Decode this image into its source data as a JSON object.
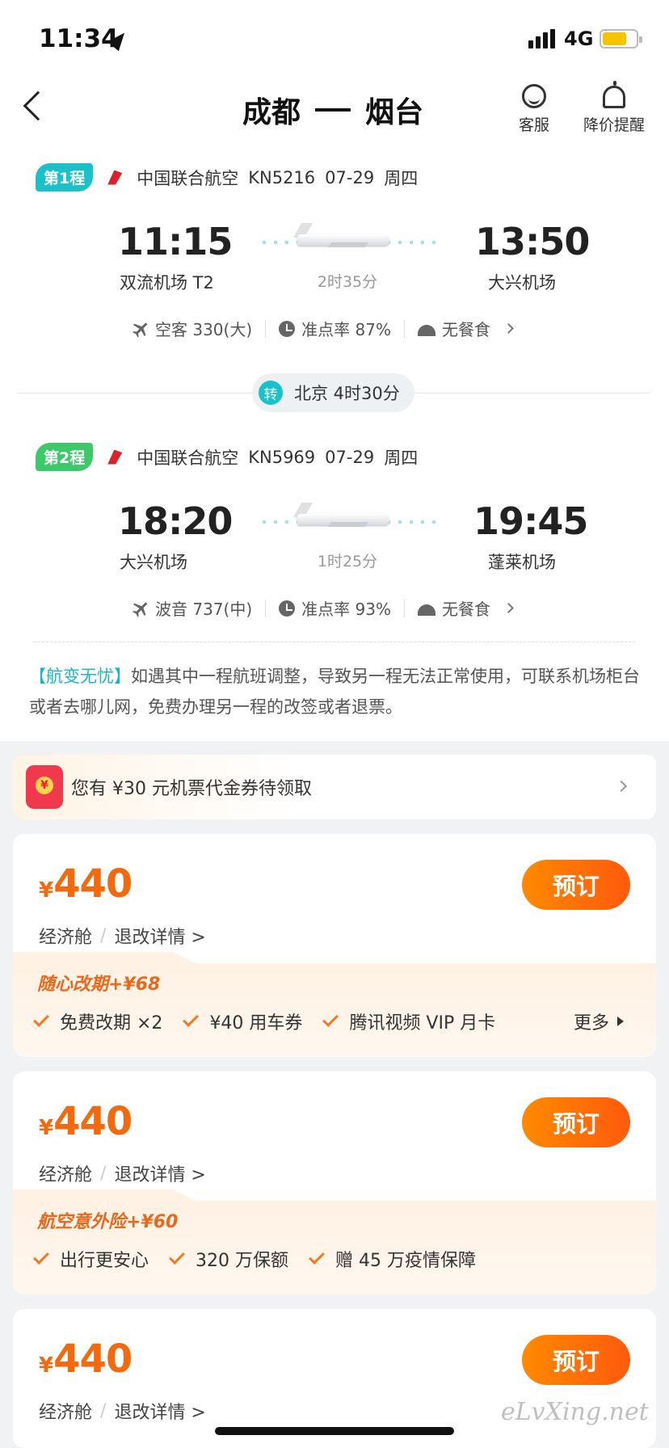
{
  "status_bar": {
    "time": "11:34",
    "network": "4G",
    "battery_level": 0.72
  },
  "header": {
    "origin": "成都",
    "destination": "烟台",
    "service_label": "客服",
    "price_alert_label": "降价提醒"
  },
  "legs": [
    {
      "badge": "第1程",
      "badge_color": "#1cc0c8",
      "airline": "中国联合航空",
      "flight_no": "KN5216",
      "date": "07-29",
      "weekday": "周四",
      "dep_time": "11:15",
      "dep_airport": "双流机场 T2",
      "duration": "2时35分",
      "arr_time": "13:50",
      "arr_airport": "大兴机场",
      "aircraft": "空客 330(大)",
      "on_time": "准点率 87%",
      "meal": "无餐食"
    },
    {
      "badge": "第2程",
      "badge_color": "#3fc86a",
      "airline": "中国联合航空",
      "flight_no": "KN5969",
      "date": "07-29",
      "weekday": "周四",
      "dep_time": "18:20",
      "dep_airport": "大兴机场",
      "duration": "1时25分",
      "arr_time": "19:45",
      "arr_airport": "蓬莱机场",
      "aircraft": "波音 737(中)",
      "on_time": "准点率 93%",
      "meal": "无餐食"
    }
  ],
  "transfer": {
    "icon_text": "转",
    "text": "北京 4时30分"
  },
  "notice": {
    "tag": "【航变无忧】",
    "text": "如遇其中一程航班调整，导致另一程无法正常使用，可联系机场柜台或者去哪儿网，免费办理另一程的改签或者退票。"
  },
  "coupon": {
    "text": "您有 ¥30 元机票代金券待领取"
  },
  "offers": [
    {
      "currency": "¥",
      "price": "440",
      "cabin": "经济舱",
      "rules": "退改详情 >",
      "book_label": "预订",
      "addon_title": "随心改期+¥68",
      "addon_items": [
        "免费改期 ×2",
        "¥40 用车券",
        "腾讯视频 VIP 月卡"
      ],
      "more_label": "更多"
    },
    {
      "currency": "¥",
      "price": "440",
      "cabin": "经济舱",
      "rules": "退改详情 >",
      "book_label": "预订",
      "addon_title": "航空意外险+¥60",
      "addon_items": [
        "出行更安心",
        "320 万保额",
        "赠 45 万疫情保障"
      ]
    },
    {
      "currency": "¥",
      "price": "440",
      "cabin": "经济舱",
      "rules": "退改详情 >",
      "book_label": "预订"
    }
  ],
  "watermark": "eLvXing.net",
  "colors": {
    "accent_orange": "#f26a0d",
    "teal": "#18b7c0"
  }
}
